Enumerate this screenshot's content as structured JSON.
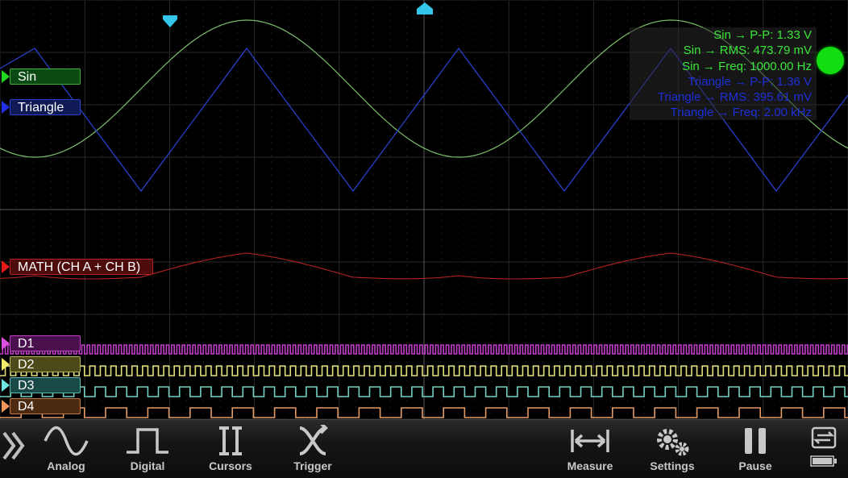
{
  "channels": {
    "sin": {
      "label": "Sin",
      "color": "#7bbf6a"
    },
    "triangle": {
      "label": "Triangle",
      "color": "#2a3fc9"
    },
    "math": {
      "label": "MATH (CH A + CH B)",
      "color": "#b22222"
    },
    "d1": {
      "label": "D1",
      "color": "#c13fc8"
    },
    "d2": {
      "label": "D2",
      "color": "#e0df7a"
    },
    "d3": {
      "label": "D3",
      "color": "#76d1c4"
    },
    "d4": {
      "label": "D4",
      "color": "#e29a66"
    }
  },
  "measurements": {
    "sin_pp": "Sin → P-P: 1.33 V",
    "sin_rms": "Sin → RMS: 473.79 mV",
    "sin_freq": "Sin → Freq: 1000.00 Hz",
    "tri_pp": "Triangle → P-P: 1.36 V",
    "tri_rms": "Triangle → RMS: 395.61 mV",
    "tri_freq": "Triangle → Freq: 2.00 kHz"
  },
  "toolbar": {
    "expand": "expand-chevrons-icon",
    "analog": "Analog",
    "digital": "Digital",
    "cursors": "Cursors",
    "trigger": "Trigger",
    "measure": "Measure",
    "settings": "Settings",
    "pause": "Pause"
  },
  "colors": {
    "run_indicator": "#11dd11",
    "trigger_marker": "#33c6e8"
  }
}
